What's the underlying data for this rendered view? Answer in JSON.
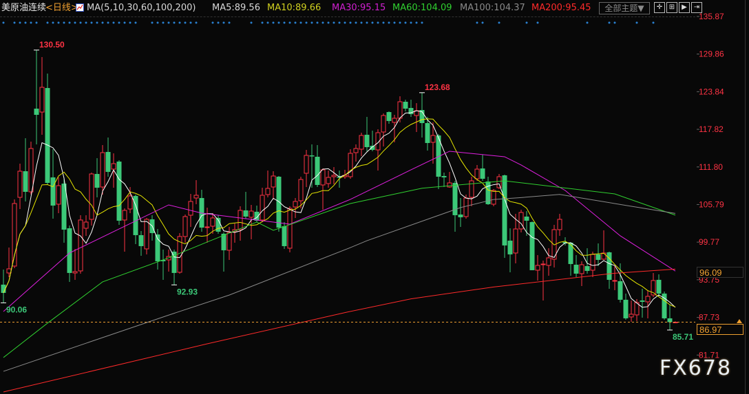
{
  "header": {
    "symbol": "美原油连续",
    "period": "<日线>",
    "indicator_icon": "chart-indicator-icon",
    "ma_params": "MA(5,10,30,60,100,200)",
    "ma5": "MA5:89.56",
    "ma10": "MA10:89.66",
    "ma30": "MA30:95.15",
    "ma60": "MA60:104.09",
    "ma100": "MA100:104.37",
    "ma200": "MA200:95.45",
    "theme_button": "全部主题▼",
    "tool_icons": [
      "crosshair-icon",
      "interval-icon",
      "play-icon",
      "goto-end-icon"
    ]
  },
  "colors": {
    "up": "#ff3344",
    "down": "#3cc878",
    "ma5": "#ffffff",
    "ma10": "#e6e600",
    "ma30": "#e020e0",
    "ma60": "#30d030",
    "ma100": "#8a8a8a",
    "ma200": "#ff2a2a",
    "axis": "#ff3344",
    "current_price": "#f0a030"
  },
  "price_boxes": {
    "current": "86.97",
    "marker": "96.09"
  },
  "watermark": "FX678",
  "chart_data": {
    "type": "candlestick",
    "ylim": [
      81.71,
      135.87
    ],
    "y_ticks": [
      "135.87",
      "129.86",
      "123.84",
      "117.82",
      "111.80",
      "105.79",
      "99.77",
      "93.75",
      "87.73",
      "81.71"
    ],
    "current_price": 86.97,
    "candles": [
      [
        92.97,
        95.39,
        90.06,
        91.65
      ],
      [
        94.84,
        98.91,
        94.18,
        95.5
      ],
      [
        95.94,
        106.61,
        95.61,
        105.95
      ],
      [
        106.94,
        112.33,
        105.07,
        111.12
      ],
      [
        111.12,
        116.4,
        106.28,
        107.82
      ],
      [
        107.82,
        115.85,
        107.38,
        114.75
      ],
      [
        121.13,
        130.5,
        115.41,
        120.14
      ],
      [
        120.58,
        129.38,
        116.95,
        124.54
      ],
      [
        124.43,
        126.74,
        109.03,
        109.25
      ],
      [
        110.13,
        114.64,
        103.53,
        105.62
      ],
      [
        105.84,
        110.13,
        104.41,
        108.81
      ],
      [
        109.14,
        110.13,
        99.68,
        101.77
      ],
      [
        101.99,
        102.43,
        93.41,
        94.84
      ],
      [
        94.84,
        98.69,
        93.74,
        95.06
      ],
      [
        95.17,
        104.08,
        94.73,
        103.31
      ],
      [
        101.99,
        104.08,
        100.78,
        102.98
      ],
      [
        103.42,
        110.9,
        102.43,
        110.68
      ],
      [
        110.68,
        113.21,
        106.94,
        108.48
      ],
      [
        108.59,
        115.3,
        107.38,
        114.09
      ],
      [
        114.2,
        116.51,
        110.24,
        111.01
      ],
      [
        111.45,
        113.98,
        108.48,
        112.33
      ],
      [
        112.66,
        112.88,
        102.54,
        103.2
      ],
      [
        103.31,
        105.18,
        98.25,
        104.85
      ],
      [
        105.07,
        108.59,
        104.41,
        107.16
      ],
      [
        107.16,
        107.38,
        99.46,
        100.89
      ],
      [
        100.89,
        101.55,
        97.59,
        99.13
      ],
      [
        98.69,
        103.64,
        97.81,
        103.42
      ],
      [
        103.42,
        104.08,
        100.01,
        101.22
      ],
      [
        101.0,
        101.88,
        95.39,
        96.71
      ],
      [
        96.93,
        98.58,
        93.74,
        96.71
      ],
      [
        96.93,
        98.58,
        95.06,
        97.48
      ],
      [
        98.25,
        98.58,
        92.93,
        94.84
      ],
      [
        94.95,
        101.22,
        94.73,
        100.67
      ],
      [
        100.67,
        104.19,
        99.68,
        103.86
      ],
      [
        104.08,
        107.49,
        102.21,
        106.28
      ],
      [
        106.83,
        109.69,
        105.84,
        107.27
      ],
      [
        106.83,
        108.15,
        101.44,
        102.1
      ],
      [
        102.1,
        105.29,
        99.68,
        102.21
      ],
      [
        102.32,
        104.41,
        101.11,
        103.64
      ],
      [
        103.64,
        104.08,
        101.11,
        101.44
      ],
      [
        101.11,
        101.33,
        95.06,
        98.47
      ],
      [
        98.47,
        102.21,
        96.93,
        101.33
      ],
      [
        101.44,
        102.76,
        99.68,
        101.77
      ],
      [
        101.77,
        105.51,
        100.01,
        104.85
      ],
      [
        104.85,
        107.82,
        103.53,
        103.86
      ],
      [
        103.75,
        105.73,
        100.23,
        104.74
      ],
      [
        104.63,
        105.62,
        102.98,
        103.2
      ],
      [
        103.31,
        108.48,
        102.98,
        107.27
      ],
      [
        107.38,
        111.23,
        106.94,
        108.37
      ],
      [
        108.59,
        111.12,
        106.61,
        110.35
      ],
      [
        110.24,
        110.35,
        101.44,
        102.1
      ],
      [
        102.32,
        102.98,
        98.69,
        99.13
      ],
      [
        98.8,
        105.51,
        98.14,
        105.18
      ],
      [
        105.4,
        106.83,
        103.64,
        106.28
      ],
      [
        106.39,
        110.24,
        105.18,
        109.8
      ],
      [
        110.79,
        114.53,
        108.59,
        113.65
      ],
      [
        113.65,
        115.41,
        108.48,
        113.54
      ],
      [
        113.43,
        115.3,
        108.59,
        108.92
      ],
      [
        108.92,
        111.56,
        104.96,
        111.34
      ],
      [
        109.14,
        111.23,
        108.48,
        110.13
      ],
      [
        110.24,
        111.78,
        109.03,
        110.46
      ],
      [
        110.24,
        111.23,
        108.48,
        110.13
      ],
      [
        110.24,
        111.34,
        109.91,
        110.46
      ],
      [
        110.24,
        114.64,
        109.91,
        113.98
      ],
      [
        114.09,
        115.41,
        112.66,
        114.75
      ],
      [
        114.64,
        117.28,
        113.54,
        116.84
      ],
      [
        116.95,
        119.81,
        114.31,
        114.97
      ],
      [
        115.19,
        117.61,
        114.31,
        114.53
      ],
      [
        114.53,
        117.83,
        111.23,
        117.28
      ],
      [
        117.39,
        120.36,
        115.08,
        120.03
      ],
      [
        120.58,
        120.69,
        118.71,
        119.15
      ],
      [
        118.93,
        120.14,
        115.74,
        119.59
      ],
      [
        119.59,
        123.11,
        118.93,
        122.23
      ],
      [
        122.23,
        122.56,
        120.69,
        121.13
      ],
      [
        121.24,
        122.56,
        119.81,
        120.25
      ],
      [
        120.03,
        122.01,
        117.39,
        120.8
      ],
      [
        120.91,
        123.68,
        116.51,
        118.82
      ],
      [
        118.82,
        119.81,
        114.42,
        115.63
      ],
      [
        115.74,
        118.93,
        112.33,
        116.84
      ],
      [
        116.84,
        117.06,
        108.26,
        110.24
      ],
      [
        110.35,
        110.9,
        108.59,
        110.13
      ],
      [
        108.59,
        111.01,
        108.48,
        109.25
      ],
      [
        109.25,
        109.58,
        101.44,
        104.08
      ],
      [
        104.19,
        106.83,
        102.21,
        103.75
      ],
      [
        103.86,
        107.38,
        103.53,
        106.83
      ],
      [
        106.94,
        110.24,
        105.51,
        109.58
      ],
      [
        109.91,
        112.11,
        109.58,
        111.45
      ],
      [
        111.56,
        113.76,
        109.58,
        109.91
      ],
      [
        109.47,
        110.24,
        105.73,
        105.84
      ],
      [
        105.84,
        108.26,
        105.51,
        108.04
      ],
      [
        108.48,
        110.68,
        108.26,
        110.24
      ],
      [
        110.46,
        110.57,
        97.26,
        99.24
      ],
      [
        100.01,
        101.99,
        94.95,
        97.81
      ],
      [
        98.03,
        104.3,
        96.38,
        101.88
      ],
      [
        101.88,
        104.96,
        101.33,
        104.52
      ],
      [
        103.86,
        104.74,
        100.78,
        103.2
      ],
      [
        102.98,
        103.09,
        95.28,
        95.28
      ],
      [
        95.28,
        97.7,
        93.63,
        96.05
      ],
      [
        96.16,
        96.82,
        90.44,
        96.27
      ],
      [
        96.05,
        98.8,
        94.4,
        97.26
      ],
      [
        97.04,
        102.54,
        95.72,
        101.77
      ],
      [
        101.77,
        104.3,
        100.78,
        103.42
      ],
      [
        99.79,
        100.56,
        99.24,
        99.57
      ],
      [
        99.68,
        99.79,
        94.4,
        96.27
      ],
      [
        96.16,
        97.7,
        94.18,
        94.73
      ],
      [
        94.73,
        96.71,
        92.75,
        96.16
      ],
      [
        95.94,
        98.8,
        94.73,
        95.17
      ],
      [
        95.28,
        98.25,
        94.18,
        97.81
      ],
      [
        97.81,
        99.57,
        95.94,
        96.93
      ],
      [
        97.04,
        101.66,
        96.93,
        98.03
      ],
      [
        98.14,
        98.25,
        92.31,
        93.74
      ],
      [
        93.52,
        95.94,
        92.09,
        93.63
      ],
      [
        93.52,
        96.38,
        90.11,
        90.55
      ],
      [
        90.55,
        91.54,
        87.36,
        87.58
      ],
      [
        87.8,
        90.44,
        87.03,
        88.24
      ],
      [
        88.13,
        90.66,
        87.14,
        90.11
      ],
      [
        90.44,
        92.31,
        87.69,
        90.22
      ],
      [
        90.22,
        92.09,
        87.58,
        91.1
      ],
      [
        91.32,
        94.84,
        90.99,
        93.63
      ],
      [
        93.74,
        94.62,
        90.99,
        91.54
      ],
      [
        91.54,
        91.87,
        87.36,
        87.58
      ],
      [
        87.58,
        89.78,
        85.71,
        86.97
      ],
      [
        86.97,
        87.1,
        86.9,
        86.97
      ]
    ],
    "ma_series": [
      {
        "name": "MA30",
        "points": [
          [
            0,
            88.68
          ],
          [
            12,
            98.03
          ],
          [
            30,
            105.73
          ],
          [
            36,
            104.41
          ],
          [
            46,
            103.31
          ],
          [
            52,
            102.65
          ],
          [
            63,
            106.61
          ],
          [
            74,
            111.34
          ],
          [
            81,
            114.31
          ],
          [
            91,
            113.43
          ],
          [
            94,
            112.11
          ],
          [
            102,
            108.04
          ],
          [
            112,
            100.78
          ],
          [
            122,
            95.15
          ]
        ]
      },
      {
        "name": "MA60",
        "points": [
          [
            0,
            81.31
          ],
          [
            8,
            86.81
          ],
          [
            18,
            93.41
          ],
          [
            30,
            97.26
          ],
          [
            37,
            99.79
          ],
          [
            46,
            102.98
          ],
          [
            49,
            101.66
          ],
          [
            63,
            105.95
          ],
          [
            76,
            108.4
          ],
          [
            91,
            109.58
          ],
          [
            111,
            107.49
          ],
          [
            122,
            104.09
          ]
        ]
      },
      {
        "name": "MA100",
        "points": [
          [
            0,
            79.1
          ],
          [
            30,
            88.1
          ],
          [
            41,
            91.3
          ],
          [
            63,
            98.9
          ],
          [
            66,
            100.0
          ],
          [
            83,
            105.3
          ],
          [
            89,
            106.6
          ],
          [
            94,
            106.9
          ],
          [
            101,
            107.4
          ],
          [
            112,
            105.8
          ],
          [
            122,
            104.37
          ]
        ]
      },
      {
        "name": "MA200",
        "points": [
          [
            0,
            75.8
          ],
          [
            37,
            83.5
          ],
          [
            62,
            88.5
          ],
          [
            74,
            90.7
          ],
          [
            89,
            92.6
          ],
          [
            111,
            94.8
          ],
          [
            122,
            95.45
          ]
        ]
      }
    ],
    "annotations": [
      {
        "text": "130.50",
        "index": 6,
        "price": 130.5,
        "kind": "high"
      },
      {
        "text": "123.68",
        "index": 76,
        "price": 123.68,
        "kind": "high"
      },
      {
        "text": "92.93",
        "index": 31,
        "price": 92.93,
        "kind": "low"
      },
      {
        "text": "90.06",
        "index": 0,
        "price": 90.06,
        "kind": "low"
      },
      {
        "text": "85.71",
        "index": 121,
        "price": 85.71,
        "kind": "low"
      }
    ],
    "signal_dots": [
      0,
      2,
      3,
      4,
      5,
      6,
      8,
      9,
      10,
      11,
      12,
      13,
      14,
      15,
      16,
      17,
      18,
      19,
      20,
      21,
      22,
      23,
      24,
      27,
      28,
      29,
      30,
      31,
      32,
      33,
      34,
      35,
      38,
      39,
      40,
      41,
      45,
      47,
      48,
      49,
      50,
      51,
      52,
      53,
      54,
      55,
      56,
      57,
      58,
      59,
      60,
      61,
      62,
      63,
      64,
      65,
      66,
      67,
      68,
      69,
      70,
      71,
      72,
      73,
      74,
      75,
      76,
      86,
      87,
      90,
      95,
      97,
      106,
      110,
      111,
      115,
      118
    ]
  }
}
